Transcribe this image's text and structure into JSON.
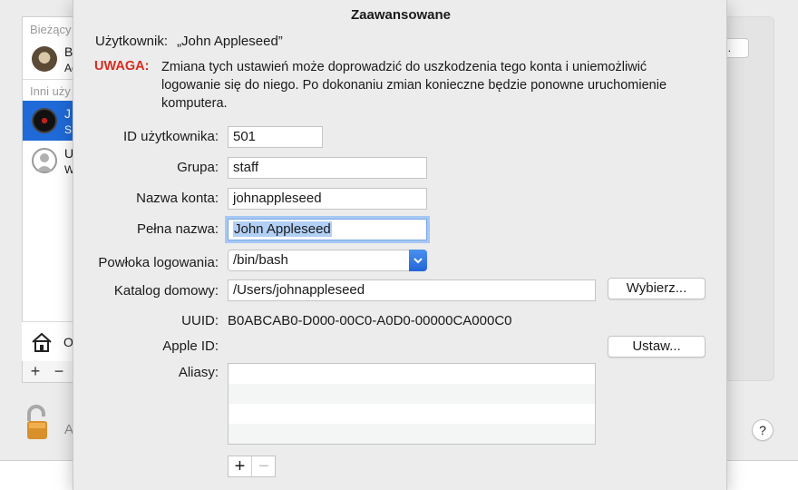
{
  "background": {
    "section_current": "Bieżący",
    "section_other": "Inni uży",
    "users": [
      {
        "name": "B",
        "sub": "Ad"
      },
      {
        "name": "J",
        "sub": "S"
      },
      {
        "name": "U",
        "sub": "W"
      }
    ],
    "login_options": "O",
    "lock_text": "A",
    "plus": "+",
    "minus": "−",
    "right_button": "..",
    "help": "?"
  },
  "sheet": {
    "title": "Zaawansowane",
    "user_label": "Użytkownik:",
    "user_name": "„John Appleseed”",
    "warning_label": "UWAGA:",
    "warning_text": "Zmiana tych ustawień może doprowadzić do uszkodzenia tego konta i uniemożliwić logowanie się do niego. Po dokonaniu zmian konieczne będzie ponowne uruchomienie komputera."
  },
  "form": {
    "user_id": {
      "label": "ID użytkownika:",
      "value": "501"
    },
    "group": {
      "label": "Grupa:",
      "value": "staff"
    },
    "account_name": {
      "label": "Nazwa konta:",
      "value": "johnappleseed"
    },
    "full_name": {
      "label": "Pełna nazwa:",
      "value": "John Appleseed"
    },
    "login_shell": {
      "label": "Powłoka logowania:",
      "value": "/bin/bash"
    },
    "home_dir": {
      "label": "Katalog domowy:",
      "value": "/Users/johnappleseed",
      "button": "Wybierz..."
    },
    "uuid": {
      "label": "UUID:",
      "value": "B0ABCAB0-D000-00C0-A0D0-00000CA000C0"
    },
    "apple_id": {
      "label": "Apple ID:",
      "button": "Ustaw..."
    },
    "aliases": {
      "label": "Aliasy:",
      "add": "+",
      "remove": "−"
    }
  },
  "colors": {
    "warning": "#d62d20",
    "selection": "#1f6ad8",
    "focus_ring": "#a6c8f5"
  }
}
